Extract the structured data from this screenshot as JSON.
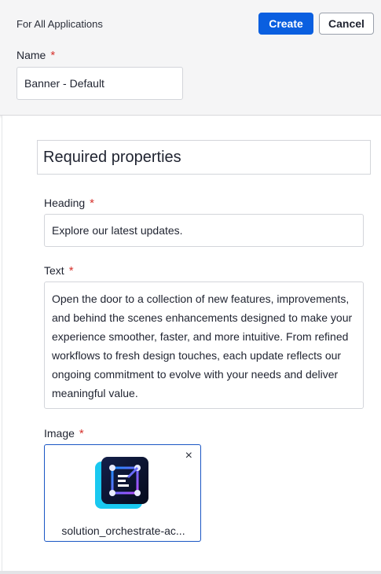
{
  "header": {
    "scope_label": "For All Applications",
    "create_label": "Create",
    "cancel_label": "Cancel",
    "name_label": "Name",
    "name_value": "Banner - Default",
    "required_mark": "*"
  },
  "section": {
    "title": "Required properties"
  },
  "fields": {
    "heading_label": "Heading",
    "heading_value": "Explore our latest updates.",
    "text_label": "Text",
    "text_value": "Open the door to a collection of new features, improvements, and behind the scenes enhancements designed to make your experience smoother, faster, and more intuitive. From refined workflows to fresh design touches, each update reflects our ongoing commitment to evolve with your needs and deliver meaningful value.",
    "image_label": "Image",
    "image_filename": "solution_orchestrate-ac...",
    "remove_icon": "×"
  },
  "colors": {
    "primary": "#0a5fe0",
    "required": "#d6312c",
    "selected_border": "#1a56c4",
    "icon_accent": "#19c8f0"
  }
}
